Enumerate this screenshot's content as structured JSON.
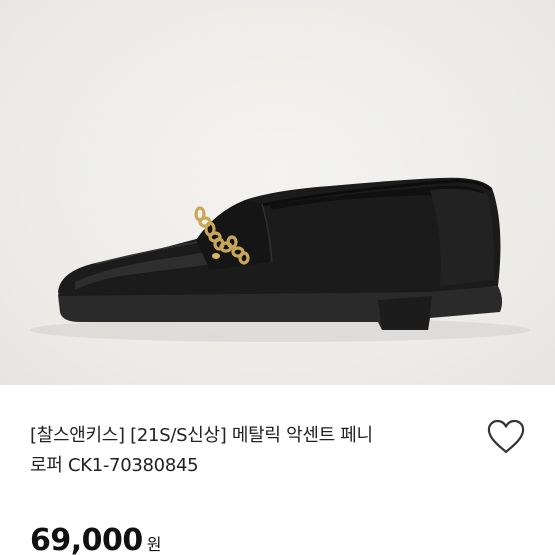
{
  "product": {
    "title_line1": "[찰스앤키스] [21S/S신상] 메탈릭 악센트 페니",
    "title_line2": "로퍼 CK1-70380845",
    "price": "69,000",
    "currency": "원"
  },
  "icons": {
    "wishlist": "heart-outline-icon"
  },
  "colors": {
    "shoe": "#1a1a1a",
    "chain": "#c9a75a",
    "background": "#ecebe8",
    "text": "#222222"
  }
}
